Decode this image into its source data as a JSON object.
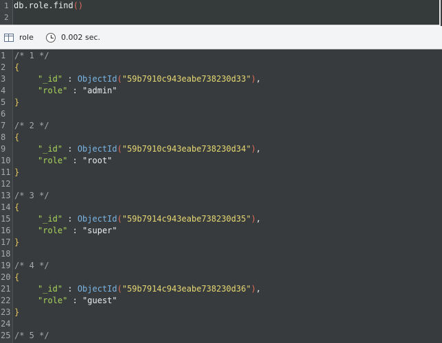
{
  "editor": {
    "lines": [
      "1",
      "2"
    ],
    "query_db": "db.role.find",
    "query_parens": "()"
  },
  "toolbar": {
    "collection": "role",
    "time": "0.002 sec.",
    "icons": [
      "table-icon",
      "clock-icon"
    ]
  },
  "results": [
    {
      "comment": "/* 1 */",
      "id": "\"59b7910c943eabe738230d33\"",
      "role": "\"admin\""
    },
    {
      "comment": "/* 2 */",
      "id": "\"59b7910c943eabe738230d34\"",
      "role": "\"root\""
    },
    {
      "comment": "/* 3 */",
      "id": "\"59b7914c943eabe738230d35\"",
      "role": "\"super\""
    },
    {
      "comment": "/* 4 */",
      "id": "\"59b7914c943eabe738230d36\"",
      "role": "\"guest\""
    },
    {
      "comment": "/* 5 */"
    }
  ],
  "tokens": {
    "open_brace": "{",
    "close_brace": "}",
    "id_key": "\"_id\"",
    "role_key": "\"role\"",
    "colon": " : ",
    "object_id": "ObjectId",
    "lparen": "(",
    "rparen_comma": "),",
    "rparen": ")"
  },
  "colors": {
    "background": "#383b3d",
    "comment": "#a5a9aa",
    "brace": "#e4c760",
    "key": "#a8d45a",
    "function": "#79b6e6",
    "string": "#e6d873",
    "paren": "#e16b5a"
  },
  "gutter": {
    "numbers": [
      "1",
      "2",
      "3",
      "4",
      "5",
      "6",
      "7",
      "8",
      "9",
      "10",
      "11",
      "12",
      "13",
      "14",
      "15",
      "16",
      "17",
      "18",
      "19",
      "20",
      "21",
      "22",
      "23",
      "24",
      "25"
    ]
  }
}
